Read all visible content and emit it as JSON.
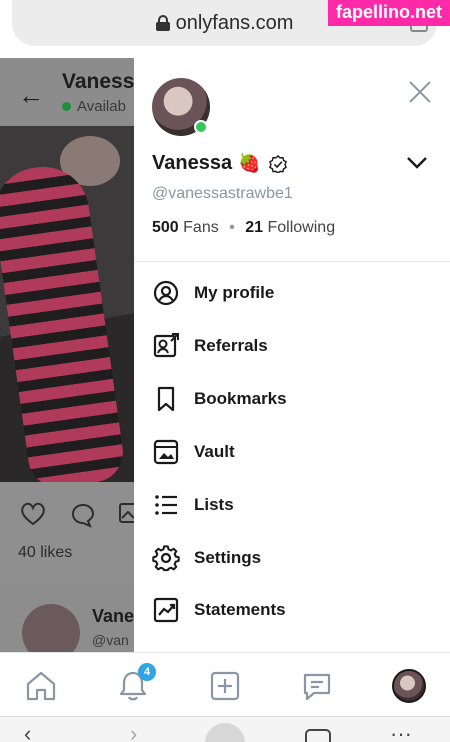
{
  "browser": {
    "url": "onlyfans.com",
    "watermark": "fapellino.net"
  },
  "background_page": {
    "back_icon": "arrow-left-icon",
    "name": "Vaness",
    "status": "Availab",
    "likes": "40 likes",
    "comment_name": "Vane",
    "comment_handle": "@van"
  },
  "drawer": {
    "name": "Vanessa",
    "name_emoji": "🍓",
    "handle": "@vanessastrawbe1",
    "fans_count": "500",
    "fans_label": "Fans",
    "separator": "•",
    "following_count": "21",
    "following_label": "Following",
    "menu": [
      {
        "label": "My profile",
        "icon": "user-circle-icon"
      },
      {
        "label": "Referrals",
        "icon": "referrals-icon"
      },
      {
        "label": "Bookmarks",
        "icon": "bookmark-icon"
      },
      {
        "label": "Vault",
        "icon": "vault-icon"
      },
      {
        "label": "Lists",
        "icon": "list-icon"
      },
      {
        "label": "Settings",
        "icon": "gear-icon"
      },
      {
        "label": "Statements",
        "icon": "chart-icon"
      }
    ]
  },
  "bottom_nav": {
    "notification_count": "4"
  },
  "colors": {
    "accent": "#2fa5e6",
    "online": "#34c759",
    "muted": "#8a96a3"
  }
}
